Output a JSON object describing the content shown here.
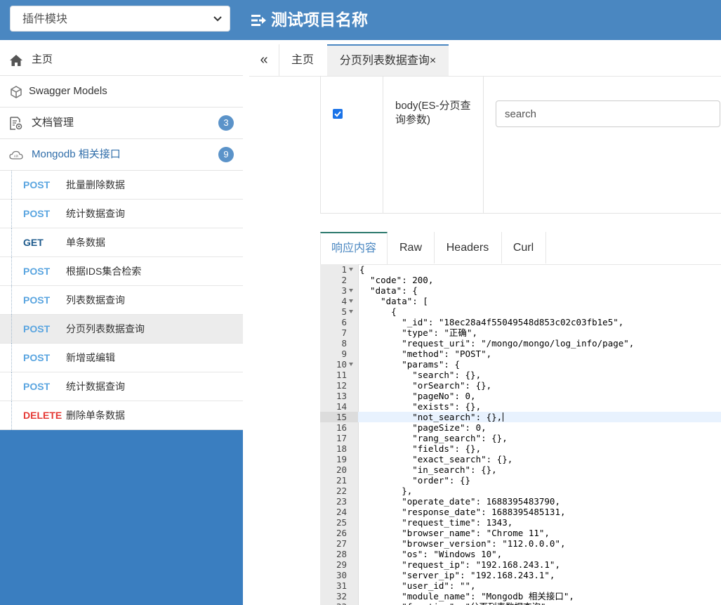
{
  "header": {
    "module_select": "插件模块",
    "project_title": "测试项目名称"
  },
  "sidebar": {
    "items": [
      {
        "label": "主页",
        "icon": "home-icon"
      },
      {
        "label": "Swagger Models",
        "icon": "cube-icon"
      },
      {
        "label": "文档管理",
        "icon": "document-settings-icon",
        "badge": "3"
      },
      {
        "label": "Mongodb 相关接口",
        "icon": "cloud-icon",
        "badge": "9"
      }
    ],
    "apis": [
      {
        "method": "POST",
        "name": "批量删除数据"
      },
      {
        "method": "POST",
        "name": "统计数据查询"
      },
      {
        "method": "GET",
        "name": "单条数据"
      },
      {
        "method": "POST",
        "name": "根据IDS集合检索"
      },
      {
        "method": "POST",
        "name": "列表数据查询"
      },
      {
        "method": "POST",
        "name": "分页列表数据查询",
        "active": true
      },
      {
        "method": "POST",
        "name": "新增或编辑"
      },
      {
        "method": "POST",
        "name": "统计数据查询"
      },
      {
        "method": "DELETE",
        "name": "删除单条数据"
      }
    ]
  },
  "tabs": {
    "collapse": "«",
    "home": "主页",
    "current": "分页列表数据查询×"
  },
  "params": {
    "name": "body(ES-分页查询参数)",
    "search_value": "search",
    "checked": true
  },
  "response_tabs": [
    "响应内容",
    "Raw",
    "Headers",
    "Curl"
  ],
  "colors": {
    "header": "#4a87c1",
    "sidebar_bg": "#3a7ec0",
    "post": "#5aa5e0",
    "get": "#1d5a8c",
    "delete": "#e53935",
    "badge": "#5b93c9"
  },
  "code": {
    "highlight_line": 15,
    "lines": [
      "{",
      "  \"code\": 200,",
      "  \"data\": {",
      "    \"data\": [",
      "      {",
      "        \"_id\": \"18ec28a4f55049548d853c02c03fb1e5\",",
      "        \"type\": \"正确\",",
      "        \"request_uri\": \"/mongo/mongo/log_info/page\",",
      "        \"method\": \"POST\",",
      "        \"params\": {",
      "          \"search\": {},",
      "          \"orSearch\": {},",
      "          \"pageNo\": 0,",
      "          \"exists\": {},",
      "          \"not_search\": {},",
      "          \"pageSize\": 0,",
      "          \"rang_search\": {},",
      "          \"fields\": {},",
      "          \"exact_search\": {},",
      "          \"in_search\": {},",
      "          \"order\": {}",
      "        },",
      "        \"operate_date\": 1688395483790,",
      "        \"response_date\": 1688395485131,",
      "        \"request_time\": 1343,",
      "        \"browser_name\": \"Chrome 11\",",
      "        \"browser_version\": \"112.0.0.0\",",
      "        \"os\": \"Windows 10\",",
      "        \"request_ip\": \"192.168.243.1\",",
      "        \"server_ip\": \"192.168.243.1\",",
      "        \"user_id\": \"\",",
      "        \"module_name\": \"Mongodb 相关接口\",",
      "        \"function\": \"分页列表数据查询\","
    ],
    "fold_lines": [
      1,
      3,
      4,
      5,
      10
    ]
  }
}
